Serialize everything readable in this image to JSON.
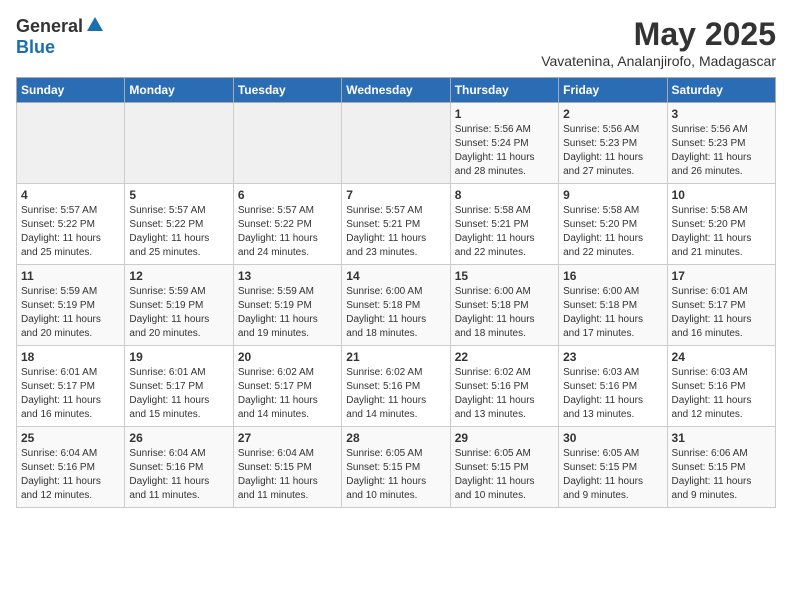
{
  "logo": {
    "general": "General",
    "blue": "Blue"
  },
  "title": {
    "month": "May 2025",
    "location": "Vavatenina, Analanjirofo, Madagascar"
  },
  "weekdays": [
    "Sunday",
    "Monday",
    "Tuesday",
    "Wednesday",
    "Thursday",
    "Friday",
    "Saturday"
  ],
  "weeks": [
    [
      {
        "day": "",
        "info": ""
      },
      {
        "day": "",
        "info": ""
      },
      {
        "day": "",
        "info": ""
      },
      {
        "day": "",
        "info": ""
      },
      {
        "day": "1",
        "info": "Sunrise: 5:56 AM\nSunset: 5:24 PM\nDaylight: 11 hours\nand 28 minutes."
      },
      {
        "day": "2",
        "info": "Sunrise: 5:56 AM\nSunset: 5:23 PM\nDaylight: 11 hours\nand 27 minutes."
      },
      {
        "day": "3",
        "info": "Sunrise: 5:56 AM\nSunset: 5:23 PM\nDaylight: 11 hours\nand 26 minutes."
      }
    ],
    [
      {
        "day": "4",
        "info": "Sunrise: 5:57 AM\nSunset: 5:22 PM\nDaylight: 11 hours\nand 25 minutes."
      },
      {
        "day": "5",
        "info": "Sunrise: 5:57 AM\nSunset: 5:22 PM\nDaylight: 11 hours\nand 25 minutes."
      },
      {
        "day": "6",
        "info": "Sunrise: 5:57 AM\nSunset: 5:22 PM\nDaylight: 11 hours\nand 24 minutes."
      },
      {
        "day": "7",
        "info": "Sunrise: 5:57 AM\nSunset: 5:21 PM\nDaylight: 11 hours\nand 23 minutes."
      },
      {
        "day": "8",
        "info": "Sunrise: 5:58 AM\nSunset: 5:21 PM\nDaylight: 11 hours\nand 22 minutes."
      },
      {
        "day": "9",
        "info": "Sunrise: 5:58 AM\nSunset: 5:20 PM\nDaylight: 11 hours\nand 22 minutes."
      },
      {
        "day": "10",
        "info": "Sunrise: 5:58 AM\nSunset: 5:20 PM\nDaylight: 11 hours\nand 21 minutes."
      }
    ],
    [
      {
        "day": "11",
        "info": "Sunrise: 5:59 AM\nSunset: 5:19 PM\nDaylight: 11 hours\nand 20 minutes."
      },
      {
        "day": "12",
        "info": "Sunrise: 5:59 AM\nSunset: 5:19 PM\nDaylight: 11 hours\nand 20 minutes."
      },
      {
        "day": "13",
        "info": "Sunrise: 5:59 AM\nSunset: 5:19 PM\nDaylight: 11 hours\nand 19 minutes."
      },
      {
        "day": "14",
        "info": "Sunrise: 6:00 AM\nSunset: 5:18 PM\nDaylight: 11 hours\nand 18 minutes."
      },
      {
        "day": "15",
        "info": "Sunrise: 6:00 AM\nSunset: 5:18 PM\nDaylight: 11 hours\nand 18 minutes."
      },
      {
        "day": "16",
        "info": "Sunrise: 6:00 AM\nSunset: 5:18 PM\nDaylight: 11 hours\nand 17 minutes."
      },
      {
        "day": "17",
        "info": "Sunrise: 6:01 AM\nSunset: 5:17 PM\nDaylight: 11 hours\nand 16 minutes."
      }
    ],
    [
      {
        "day": "18",
        "info": "Sunrise: 6:01 AM\nSunset: 5:17 PM\nDaylight: 11 hours\nand 16 minutes."
      },
      {
        "day": "19",
        "info": "Sunrise: 6:01 AM\nSunset: 5:17 PM\nDaylight: 11 hours\nand 15 minutes."
      },
      {
        "day": "20",
        "info": "Sunrise: 6:02 AM\nSunset: 5:17 PM\nDaylight: 11 hours\nand 14 minutes."
      },
      {
        "day": "21",
        "info": "Sunrise: 6:02 AM\nSunset: 5:16 PM\nDaylight: 11 hours\nand 14 minutes."
      },
      {
        "day": "22",
        "info": "Sunrise: 6:02 AM\nSunset: 5:16 PM\nDaylight: 11 hours\nand 13 minutes."
      },
      {
        "day": "23",
        "info": "Sunrise: 6:03 AM\nSunset: 5:16 PM\nDaylight: 11 hours\nand 13 minutes."
      },
      {
        "day": "24",
        "info": "Sunrise: 6:03 AM\nSunset: 5:16 PM\nDaylight: 11 hours\nand 12 minutes."
      }
    ],
    [
      {
        "day": "25",
        "info": "Sunrise: 6:04 AM\nSunset: 5:16 PM\nDaylight: 11 hours\nand 12 minutes."
      },
      {
        "day": "26",
        "info": "Sunrise: 6:04 AM\nSunset: 5:16 PM\nDaylight: 11 hours\nand 11 minutes."
      },
      {
        "day": "27",
        "info": "Sunrise: 6:04 AM\nSunset: 5:15 PM\nDaylight: 11 hours\nand 11 minutes."
      },
      {
        "day": "28",
        "info": "Sunrise: 6:05 AM\nSunset: 5:15 PM\nDaylight: 11 hours\nand 10 minutes."
      },
      {
        "day": "29",
        "info": "Sunrise: 6:05 AM\nSunset: 5:15 PM\nDaylight: 11 hours\nand 10 minutes."
      },
      {
        "day": "30",
        "info": "Sunrise: 6:05 AM\nSunset: 5:15 PM\nDaylight: 11 hours\nand 9 minutes."
      },
      {
        "day": "31",
        "info": "Sunrise: 6:06 AM\nSunset: 5:15 PM\nDaylight: 11 hours\nand 9 minutes."
      }
    ]
  ]
}
